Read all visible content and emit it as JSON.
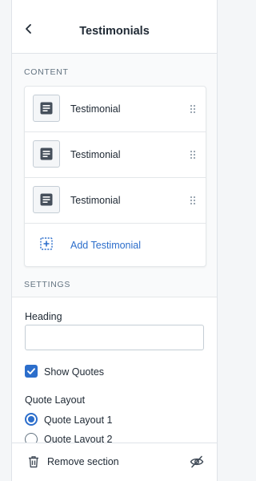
{
  "header": {
    "title": "Testimonials"
  },
  "content_section": {
    "label": "CONTENT"
  },
  "blocks": [
    {
      "label": "Testimonial"
    },
    {
      "label": "Testimonial"
    },
    {
      "label": "Testimonial"
    }
  ],
  "add_block": {
    "label": "Add Testimonial"
  },
  "settings_section": {
    "label": "SETTINGS"
  },
  "heading_field": {
    "label": "Heading",
    "value": ""
  },
  "show_quotes": {
    "label": "Show Quotes",
    "checked": true
  },
  "quote_layout": {
    "label": "Quote Layout",
    "options": [
      {
        "label": "Quote Layout 1",
        "selected": true
      },
      {
        "label": "Quote Layout 2",
        "selected": false
      }
    ]
  },
  "footer": {
    "remove_label": "Remove section"
  },
  "colors": {
    "accent": "#2c6ecb",
    "text": "#212b36",
    "muted": "#637381"
  },
  "icons": [
    "chevron-left-icon",
    "text-block-icon",
    "drag-handle-icon",
    "add-block-icon",
    "checkmark-icon",
    "trash-icon",
    "eye-hidden-icon"
  ]
}
